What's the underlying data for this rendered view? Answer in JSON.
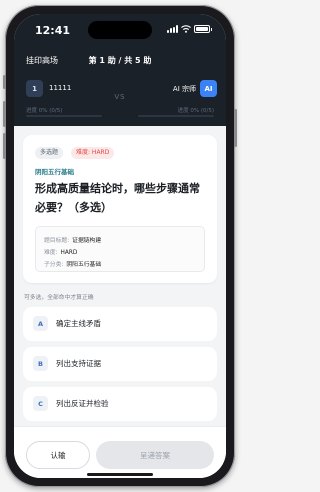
{
  "status": {
    "time": "12:41"
  },
  "header": {
    "mode": "挂印高场",
    "round": "第 1 助 / 共 5 助"
  },
  "players": {
    "left": {
      "avatar": "1",
      "name": "11111",
      "progress": "进度 0% (0/5)"
    },
    "vs": "VS",
    "right": {
      "avatar": "AI",
      "name": "AI 宗师",
      "progress": "进度 0% (0/5)"
    }
  },
  "question": {
    "type_tag": "多选题",
    "difficulty_tag": "难度: HARD",
    "topic": "阴阳五行基础",
    "text": "形成高质量结论时，哪些步骤通常必要？（多选）",
    "meta": [
      {
        "key": "题目标题:",
        "value": "证据链构建"
      },
      {
        "key": "难度:",
        "value": "HARD"
      },
      {
        "key": "子分类:",
        "value": "阴阳五行基础"
      }
    ]
  },
  "hint": "可多选，全部命中才算正确",
  "options": [
    {
      "letter": "A",
      "text": "确定主线矛盾"
    },
    {
      "letter": "B",
      "text": "列出支持证据"
    },
    {
      "letter": "C",
      "text": "列出反证并检验"
    }
  ],
  "actions": {
    "quit_label": "认输",
    "submit_label": "呈递答案"
  },
  "colors": {
    "header_bg": "#1b2129",
    "accent_blue": "#3b82f6",
    "topic_teal": "#2d7d8d",
    "hard_red": "#e04848"
  }
}
